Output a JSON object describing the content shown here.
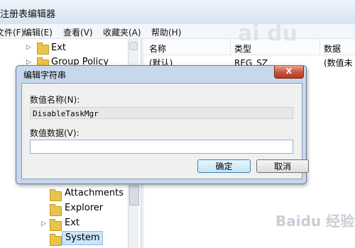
{
  "window": {
    "title": "注册表编辑器"
  },
  "menu": [
    "文件(F)",
    "编辑(E)",
    "查看(V)",
    "收藏夹(A)",
    "帮助(H)"
  ],
  "tree": {
    "items_top": [
      "Ext",
      "Group Policy"
    ],
    "items_bottom": [
      "Attachments",
      "Explorer",
      "Ext",
      "System"
    ],
    "selected": "System"
  },
  "list": {
    "columns": [
      "名称",
      "类型",
      "数据"
    ],
    "rows": [
      {
        "name": "(默认)",
        "type": "REG_SZ",
        "data": "(数值未"
      }
    ]
  },
  "dialog": {
    "title": "编辑字符串",
    "close_label": "X",
    "name_label": "数值名称(N):",
    "name_value": "DisableTaskMgr",
    "data_label": "数值数据(V):",
    "data_value": "",
    "ok_label": "确定",
    "cancel_label": "取消"
  },
  "watermark": {
    "top": "ai du",
    "bottom": "Baidu 经验"
  }
}
